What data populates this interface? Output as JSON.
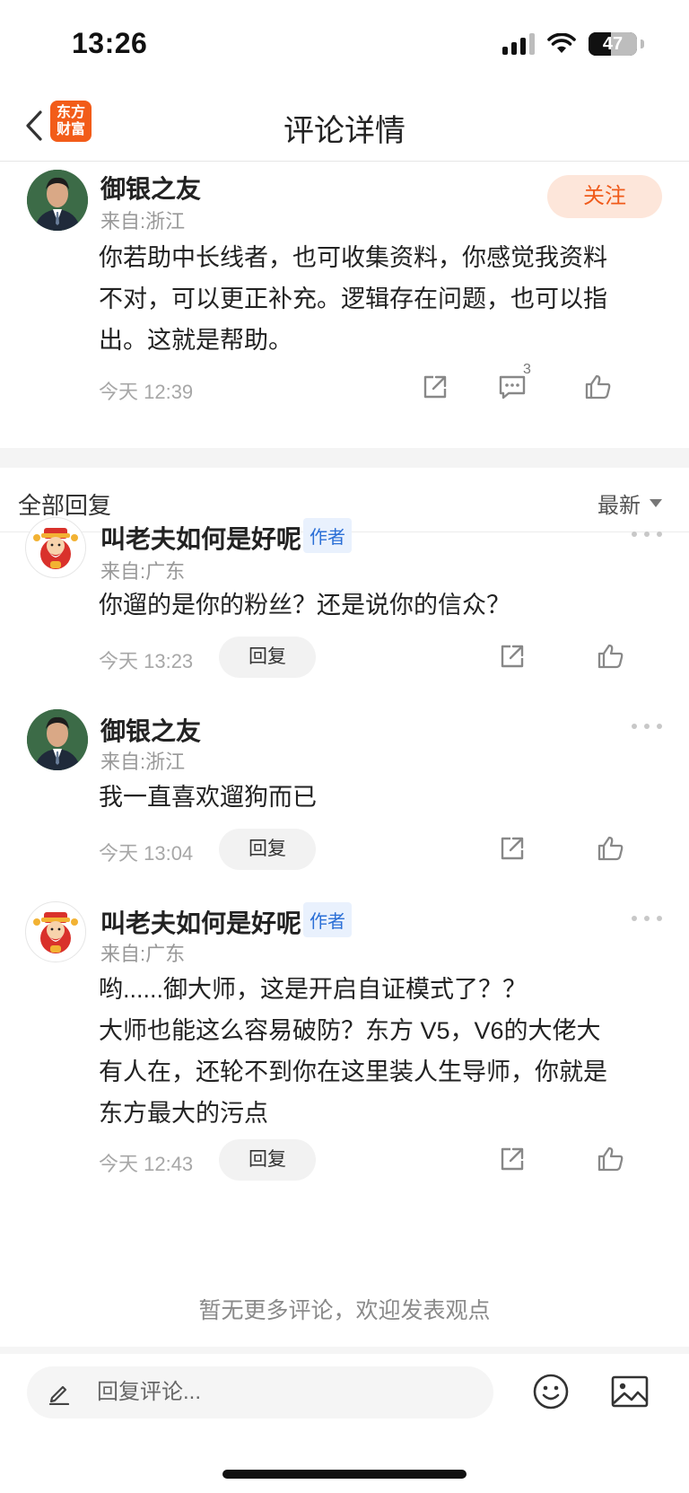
{
  "status_bar": {
    "time": "13:26",
    "battery": "47"
  },
  "nav": {
    "logo_line1": "东方",
    "logo_line2": "财富",
    "title": "评论详情"
  },
  "main_comment": {
    "author": "御银之友",
    "location": "来自:浙江",
    "follow_label": "关注",
    "text_line1": "你若助中长线者，也可收集资料，你感觉我资料",
    "text_line2": "不对，可以更正补充。逻辑存在问题，也可以指",
    "text_line3": "出。这就是帮助。",
    "time": "今天 12:39",
    "reply_count": "3"
  },
  "replies_header": {
    "title": "全部回复",
    "sort_label": "最新"
  },
  "replies": [
    {
      "author": "叫老夫如何是好呢",
      "tag": "作者",
      "location": "来自:广东",
      "text_line1": "你遛的是你的粉丝？还是说你的信众？",
      "time": "今天 13:23",
      "reply_label": "回复"
    },
    {
      "author": "御银之友",
      "location": "来自:浙江",
      "text_line1": "我一直喜欢遛狗而已",
      "time": "今天 13:04",
      "reply_label": "回复"
    },
    {
      "author": "叫老夫如何是好呢",
      "tag": "作者",
      "location": "来自:广东",
      "text_line1": "哟......御大师，这是开启自证模式了？？",
      "text_line2": "大师也能这么容易破防？东方 V5，V6的大佬大",
      "text_line3": "有人在，还轮不到你在这里装人生导师，你就是",
      "text_line4": "东方最大的污点",
      "time": "今天 12:43",
      "reply_label": "回复"
    }
  ],
  "footer_notice": "暂无更多评论，欢迎发表观点",
  "composer": {
    "placeholder": "回复评论..."
  },
  "colors": {
    "accent": "#f05a1a",
    "author_tag": "#2b6fd6",
    "secondary_text": "#a7a7a7"
  }
}
